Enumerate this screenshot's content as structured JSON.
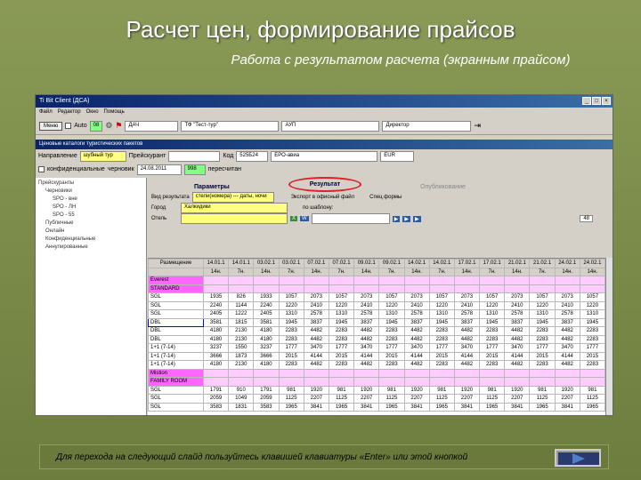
{
  "slide": {
    "title": "Расчет цен, формирование прайсов",
    "subtitle": "Работа с результатом расчета (экранным прайсом)",
    "footer_text": "Для перехода на следующий слайд пользуйтесь клавишей клавиатуры «Enter» или этой кнопкой"
  },
  "app": {
    "window_title": "Ti Bit Client (ДСА)",
    "menu": [
      "Файл",
      "Редактор",
      "Окно",
      "Помощь"
    ],
    "toolbar": {
      "menu_label": "Меню",
      "filter_label": "Auto",
      "counter": "08",
      "field1": "ДАЧ",
      "field2": "ТФ \"Тест-тур\"",
      "field3": "АУП",
      "field4": "Директор"
    },
    "subwindow_title": "Ценовые каталоги туристических пакетов",
    "direction_label": "Направление",
    "direction_value": "шубный тур",
    "price_label": "Прейскурант",
    "code_label": "Код",
    "code_value": "525Б24",
    "tour_value": "ЕРО-авиа",
    "currency_value": "EUR",
    "confidential_label": "конфиденциальные",
    "draft_label": "черновик",
    "date_value": "24.08.2011",
    "version_value": "998",
    "recalc_label": "пересчитан",
    "tree": [
      "Прейскуранты",
      "Черновики",
      "SPO - вне",
      "SPO - ЛН",
      "SPO - 55",
      "Публичные",
      "Онлайн",
      "Конфиденциальные",
      "Аннулированные"
    ]
  },
  "main": {
    "tabs": [
      "Параметры",
      "Результат",
      "Опубликование"
    ],
    "result_type_label": "Вид результата",
    "result_type_value": "стели(номера) --- даты, ночи",
    "city_label": "Город",
    "city_value": "Халкидики",
    "hotel_label": "Отель",
    "export_label": "Экспорт в офисный файл",
    "template_label": "по шаблону:",
    "special_label": "Спец формы",
    "page_indicator": "48"
  },
  "grid": {
    "header1": [
      "Размещение",
      "14.01.1",
      "14.01.1",
      "03.02.1",
      "03.02.1",
      "07.02.1",
      "07.02.1",
      "09.02.1",
      "09.02.1",
      "14.02.1",
      "14.02.1",
      "17.02.1",
      "17.02.1",
      "21.02.1",
      "21.02.1",
      "24.02.1",
      "24.02.1"
    ],
    "header2": [
      "",
      "14н.",
      "7н.",
      "14н.",
      "7н.",
      "14н.",
      "7н.",
      "14н.",
      "7н.",
      "14н.",
      "7н.",
      "14н.",
      "7н.",
      "14н.",
      "7н.",
      "14н.",
      "14н."
    ],
    "rows": [
      {
        "type": "section",
        "label": "Everest"
      },
      {
        "type": "section",
        "label": "STANDARD"
      },
      {
        "type": "data",
        "label": "SGL",
        "values": [
          "1935",
          "826",
          "1933",
          "1057",
          "2073",
          "1057",
          "2073",
          "1057",
          "2073",
          "1057",
          "2073",
          "1057",
          "2073",
          "1057",
          "2073",
          "1057"
        ]
      },
      {
        "type": "data",
        "label": "SGL",
        "values": [
          "2240",
          "1144",
          "2240",
          "1220",
          "2410",
          "1220",
          "2410",
          "1220",
          "2410",
          "1220",
          "2410",
          "1220",
          "2410",
          "1220",
          "2410",
          "1220"
        ]
      },
      {
        "type": "data",
        "label": "SGL",
        "values": [
          "2405",
          "1222",
          "2405",
          "1310",
          "2578",
          "1310",
          "2578",
          "1310",
          "2578",
          "1310",
          "2578",
          "1310",
          "2578",
          "1310",
          "2578",
          "1310"
        ]
      },
      {
        "type": "data",
        "label": "DBL",
        "selected": true,
        "values": [
          "3581",
          "1815",
          "3581",
          "1945",
          "3837",
          "1945",
          "3837",
          "1945",
          "3837",
          "1945",
          "3837",
          "1945",
          "3837",
          "1945",
          "3837",
          "1945"
        ]
      },
      {
        "type": "data",
        "label": "DBL",
        "values": [
          "4180",
          "2130",
          "4180",
          "2283",
          "4482",
          "2283",
          "4482",
          "2283",
          "4482",
          "2283",
          "4482",
          "2283",
          "4482",
          "2283",
          "4482",
          "2283"
        ]
      },
      {
        "type": "data",
        "label": "DBL",
        "values": [
          "4180",
          "2130",
          "4180",
          "2283",
          "4482",
          "2283",
          "4482",
          "2283",
          "4482",
          "2283",
          "4482",
          "2283",
          "4482",
          "2283",
          "4482",
          "2283"
        ]
      },
      {
        "type": "data",
        "label": "1+1 (7-14)",
        "values": [
          "3237",
          "1550",
          "3237",
          "1777",
          "3470",
          "1777",
          "3470",
          "1777",
          "3470",
          "1777",
          "3470",
          "1777",
          "3470",
          "1777",
          "3470",
          "1777"
        ]
      },
      {
        "type": "data",
        "label": "1+1 (7-14)",
        "values": [
          "3666",
          "1873",
          "3666",
          "2015",
          "4144",
          "2015",
          "4144",
          "2015",
          "4144",
          "2015",
          "4144",
          "2015",
          "4144",
          "2015",
          "4144",
          "2015"
        ]
      },
      {
        "type": "data",
        "label": "1+1 (7-14)",
        "values": [
          "4180",
          "2130",
          "4180",
          "2283",
          "4482",
          "2283",
          "4482",
          "2283",
          "4482",
          "2283",
          "4482",
          "2283",
          "4482",
          "2283",
          "4482",
          "2283"
        ]
      },
      {
        "type": "section",
        "label": "Mistion"
      },
      {
        "type": "section",
        "label": "FAMILY ROOM"
      },
      {
        "type": "data",
        "label": "SGL",
        "values": [
          "1791",
          "910",
          "1791",
          "981",
          "1920",
          "981",
          "1920",
          "981",
          "1920",
          "981",
          "1920",
          "981",
          "1920",
          "981",
          "1920",
          "981"
        ]
      },
      {
        "type": "data",
        "label": "SGL",
        "values": [
          "2059",
          "1049",
          "2059",
          "1125",
          "2207",
          "1125",
          "2207",
          "1125",
          "2207",
          "1125",
          "2207",
          "1125",
          "2207",
          "1125",
          "2207",
          "1125"
        ]
      },
      {
        "type": "data",
        "label": "SGL",
        "values": [
          "3583",
          "1831",
          "3583",
          "1965",
          "3841",
          "1965",
          "3841",
          "1965",
          "3841",
          "1965",
          "3841",
          "1965",
          "3841",
          "1965",
          "3841",
          "1965"
        ]
      }
    ]
  }
}
